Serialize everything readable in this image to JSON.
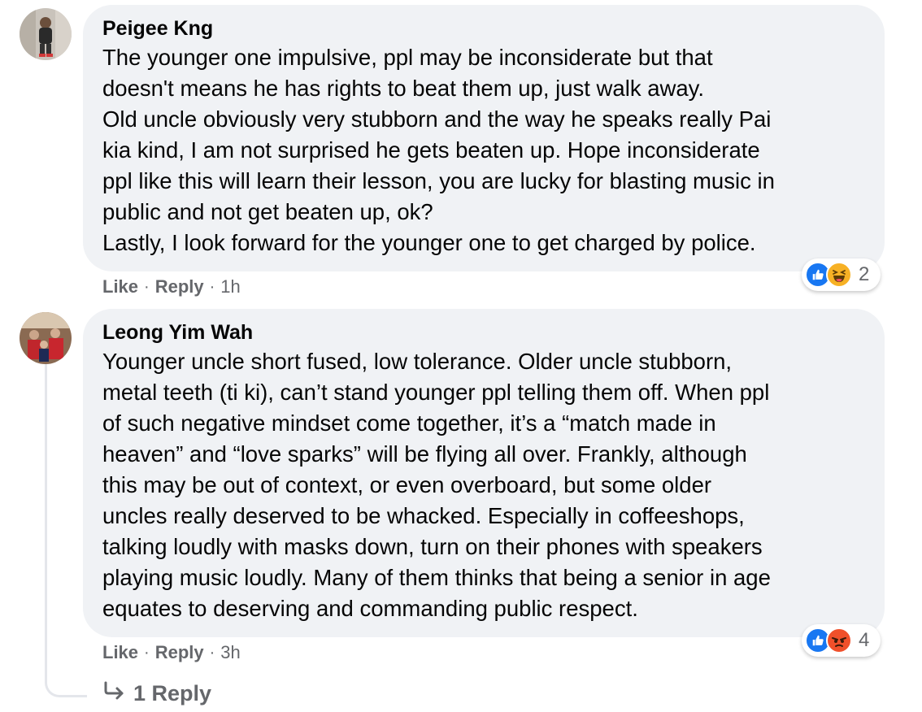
{
  "comments": [
    {
      "author": "Peigee Kng",
      "text": "The younger one impulsive, ppl may be inconsiderate but that\ndoesn't means he has rights to beat them up, just walk away.\nOld uncle obviously very stubborn and the way he speaks really Pai\nkia kind, I am not surprised he gets beaten up. Hope inconsiderate\nppl like this will learn their lesson, you are lucky for blasting music in\npublic and not get beaten up, ok?\nLastly, I look forward for the younger one to get charged by police.",
      "like_label": "Like",
      "reply_label": "Reply",
      "separator": "·",
      "time": "1h",
      "reactions": [
        "like-icon",
        "haha-icon"
      ],
      "reaction_count": "2"
    },
    {
      "author": "Leong Yim Wah",
      "text": "Younger uncle short fused, low tolerance. Older uncle stubborn,\nmetal teeth (ti ki), can’t stand younger ppl telling them off. When ppl\nof such negative mindset come together, it’s a “match made in\nheaven” and “love sparks” will be flying all over. Frankly, although\nthis may be out of context, or even overboard, but some older\nuncles really deserved to be whacked. Especially in coffeeshops,\ntalking loudly with masks down, turn on their phones with speakers\nplaying music loudly. Many of them thinks that being a senior in age\nequates to deserving and commanding public respect.",
      "like_label": "Like",
      "reply_label": "Reply",
      "separator": "·",
      "time": "3h",
      "reactions": [
        "like-icon",
        "angry-icon"
      ],
      "reaction_count": "4"
    }
  ],
  "replies_link": "1 Reply",
  "colors": {
    "bubble": "#f0f2f5",
    "meta_text": "#65676b",
    "like_blue": "#1877f2",
    "haha_yellow": "#f7b125",
    "angry_red": "#f0502b"
  }
}
